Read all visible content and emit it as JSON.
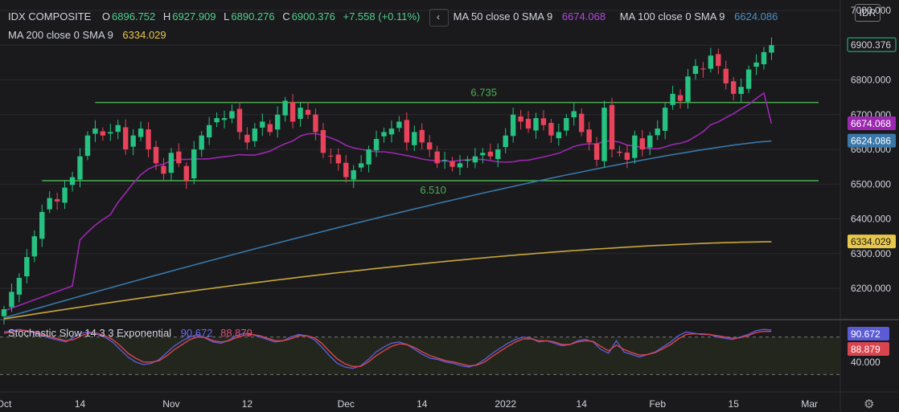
{
  "legend": {
    "symbol": "IDX COMPOSITE",
    "ohlc": {
      "o_label": "O",
      "o_value": "6896.752",
      "h_label": "H",
      "h_value": "6927.909",
      "l_label": "L",
      "l_value": "6890.276",
      "c_label": "C",
      "c_value": "6900.376",
      "change": "+7.558 (+0.11%)"
    },
    "ma50_label": "MA 50 close 0 SMA 9",
    "ma50_value": "6674.068",
    "ma100_label": "MA 100 close 0 SMA 9",
    "ma100_value": "6624.086",
    "ma200_label": "MA 200 close 0 SMA 9",
    "ma200_value": "6334.029",
    "collapse_icon": "‹",
    "stoch_label": "Stochastic Slow 14 3 3 Exponential",
    "stoch_k": "90.672",
    "stoch_d": "88.879"
  },
  "currency_button": "IDR",
  "settings_icon": "gear-icon",
  "colors": {
    "bg": "#1a1a1d",
    "grid": "#2a2a2e",
    "up": "#26c281",
    "down": "#e8435a",
    "ma50": "#9c27b0",
    "ma100": "#3a78a8",
    "ma200": "#c8a83a",
    "level": "#4caf50",
    "stochK": "#5b5bd6",
    "stochD": "#d8454f"
  },
  "chart_data": {
    "type": "candlestick",
    "title": "IDX COMPOSITE",
    "y_ticks": [
      "7000.000",
      "6900.000",
      "6800.000",
      "6700.000",
      "6600.000",
      "6500.000",
      "6400.000",
      "6300.000",
      "6200.000"
    ],
    "ylim": [
      6110,
      7030
    ],
    "x_ticks": [
      "Oct",
      "14",
      "Nov",
      "12",
      "Dec",
      "14",
      "2022",
      "14",
      "Feb",
      "15",
      "Mar"
    ],
    "x_tick_index": [
      0,
      10,
      22,
      32,
      45,
      55,
      66,
      76,
      86,
      96,
      106
    ],
    "n_slots": 108,
    "price_tags": {
      "last": "6900.376",
      "ma50": "6674.068",
      "ma100": "6624.086",
      "ma200": "6334.029"
    },
    "levels": [
      {
        "value": 6735,
        "label": "6.735",
        "start_index": 12
      },
      {
        "value": 6510,
        "label": "6.510",
        "start_index": 5
      }
    ],
    "closes": [
      6140,
      6190,
      6230,
      6290,
      6350,
      6420,
      6460,
      6450,
      6490,
      6520,
      6580,
      6640,
      6660,
      6640,
      6650,
      6670,
      6600,
      6640,
      6660,
      6600,
      6560,
      6530,
      6590,
      6560,
      6510,
      6600,
      6640,
      6670,
      6690,
      6690,
      6710,
      6650,
      6620,
      6660,
      6680,
      6650,
      6700,
      6740,
      6680,
      6720,
      6700,
      6650,
      6590,
      6580,
      6560,
      6520,
      6540,
      6560,
      6600,
      6630,
      6650,
      6660,
      6680,
      6620,
      6650,
      6620,
      6600,
      6560,
      6570,
      6550,
      6560,
      6570,
      6580,
      6590,
      6580,
      6600,
      6640,
      6700,
      6680,
      6660,
      6690,
      6670,
      6640,
      6650,
      6690,
      6710,
      6650,
      6620,
      6570,
      6720,
      6600,
      6590,
      6570,
      6640,
      6600,
      6640,
      6660,
      6720,
      6760,
      6740,
      6810,
      6840,
      6830,
      6870,
      6840,
      6790,
      6760,
      6780,
      6830,
      6850,
      6880,
      6900
    ],
    "series": [
      {
        "name": "MA 50 close 0 SMA 9",
        "values_approx": "6150 → 6674.068"
      },
      {
        "name": "MA 100 close 0 SMA 9",
        "values_approx": "6120 → 6624.086"
      },
      {
        "name": "MA 200 close 0 SMA 9",
        "values_approx": "6120 → 6334.029"
      }
    ],
    "stochastic": {
      "levels": [
        80,
        20
      ],
      "y_tick": "40.000",
      "k_last": 90.672,
      "d_last": 88.879,
      "k": [
        88,
        90,
        92,
        90,
        86,
        82,
        78,
        75,
        72,
        80,
        86,
        88,
        84,
        80,
        72,
        60,
        48,
        40,
        36,
        38,
        44,
        55,
        66,
        74,
        80,
        84,
        78,
        72,
        70,
        75,
        82,
        86,
        84,
        80,
        76,
        72,
        74,
        80,
        84,
        82,
        76,
        64,
        50,
        38,
        32,
        30,
        34,
        44,
        56,
        64,
        70,
        72,
        68,
        60,
        52,
        46,
        44,
        40,
        38,
        34,
        32,
        36,
        44,
        54,
        62,
        70,
        76,
        80,
        78,
        72,
        74,
        70,
        66,
        68,
        74,
        76,
        72,
        60,
        54,
        74,
        56,
        52,
        48,
        52,
        56,
        64,
        72,
        82,
        88,
        86,
        84,
        84,
        80,
        78,
        76,
        80,
        84,
        90,
        92,
        91
      ],
      "d": [
        86,
        88,
        90,
        90,
        88,
        84,
        80,
        77,
        74,
        76,
        82,
        86,
        86,
        82,
        76,
        66,
        54,
        46,
        40,
        40,
        42,
        50,
        60,
        68,
        76,
        80,
        79,
        74,
        72,
        74,
        79,
        83,
        84,
        82,
        78,
        74,
        74,
        77,
        82,
        82,
        79,
        70,
        57,
        45,
        37,
        33,
        33,
        40,
        50,
        58,
        65,
        69,
        68,
        63,
        56,
        50,
        46,
        42,
        40,
        37,
        34,
        35,
        40,
        49,
        57,
        65,
        72,
        77,
        77,
        74,
        74,
        72,
        68,
        68,
        72,
        74,
        73,
        65,
        58,
        67,
        60,
        55,
        51,
        52,
        55,
        61,
        68,
        77,
        84,
        85,
        85,
        84,
        82,
        80,
        78,
        79,
        82,
        87,
        89,
        88.879
      ]
    }
  }
}
